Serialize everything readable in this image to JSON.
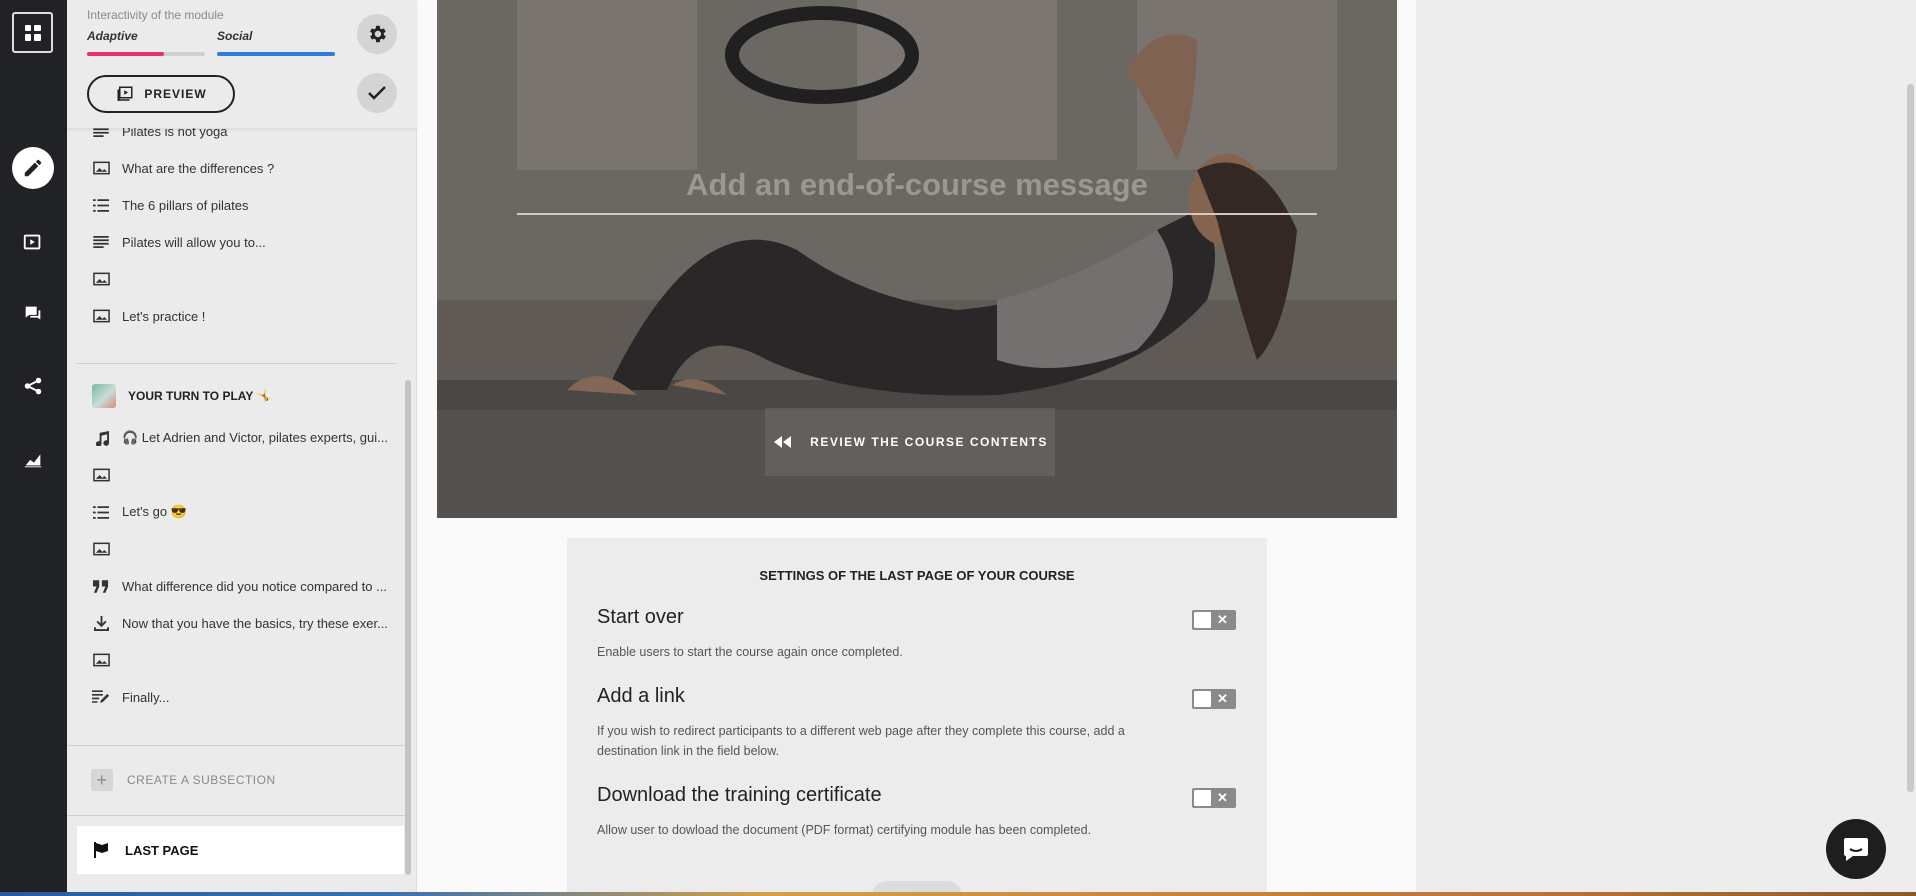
{
  "sidebar": {
    "interactivity_title": "Interactivity of the module",
    "adaptive_label": "Adaptive",
    "social_label": "Social",
    "adaptive_level": 0.65,
    "social_level": 1.0,
    "preview_label": "PREVIEW",
    "items": [
      {
        "icon": "text-lines-icon",
        "label": "Pilates is not yoga"
      },
      {
        "icon": "image-icon",
        "label": "What are the differences ?"
      },
      {
        "icon": "list-icon",
        "label": "The 6 pillars of pilates"
      },
      {
        "icon": "text-lines-icon",
        "label": "Pilates will allow you to..."
      },
      {
        "icon": "image-icon",
        "label": ""
      },
      {
        "icon": "image-icon",
        "label": "Let's practice !"
      }
    ],
    "section_title": "YOUR TURN TO PLAY 🤸",
    "section_items": [
      {
        "icon": "music-note-icon",
        "label": "🎧 Let Adrien and Victor, pilates experts, gui..."
      },
      {
        "icon": "image-icon",
        "label": ""
      },
      {
        "icon": "list-icon",
        "label": "Let's go 😎"
      },
      {
        "icon": "image-icon",
        "label": ""
      },
      {
        "icon": "quote-icon",
        "label": "What difference did you notice compared to ..."
      },
      {
        "icon": "download-icon",
        "label": "Now that you have the basics, try these exer..."
      },
      {
        "icon": "image-icon",
        "label": ""
      },
      {
        "icon": "edit-note-icon",
        "label": "Finally..."
      }
    ],
    "create_subsection": "CREATE A SUBSECTION",
    "last_page": "LAST PAGE"
  },
  "main": {
    "end_message_placeholder": "Add an end-of-course message",
    "review_button": "REVIEW THE COURSE CONTENTS",
    "settings": {
      "title": "SETTINGS OF THE LAST PAGE OF YOUR COURSE",
      "options": [
        {
          "title": "Start over",
          "desc": "Enable users to start the course again once completed.",
          "enabled": false
        },
        {
          "title": "Add a link",
          "desc": "If you wish to redirect participants to a different web page after they complete this course, add a destination link in the field below.",
          "enabled": false
        },
        {
          "title": "Download the training certificate",
          "desc": "Allow user to dowload the document (PDF format) certifying module has been completed.",
          "enabled": false
        }
      ]
    }
  },
  "colors": {
    "adaptive": "#e8306f",
    "social": "#2f7bdc",
    "rail": "#202225"
  }
}
